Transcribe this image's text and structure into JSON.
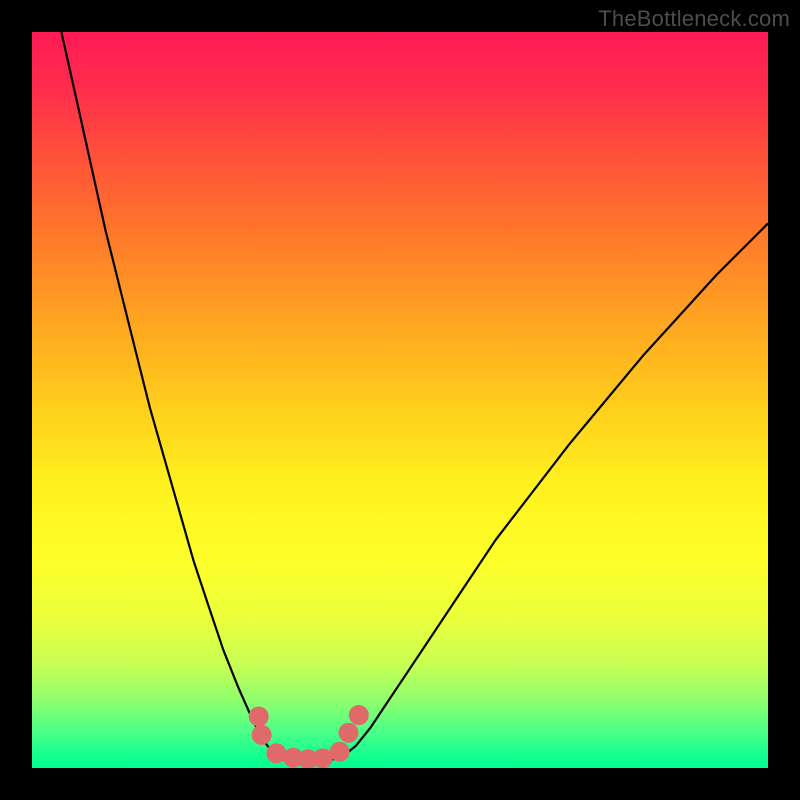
{
  "attribution": "TheBottleneck.com",
  "chart_data": {
    "type": "line",
    "title": "",
    "xlabel": "",
    "ylabel": "",
    "xlim": [
      0,
      100
    ],
    "ylim": [
      0,
      100
    ],
    "series": [
      {
        "name": "left-curve",
        "x": [
          4,
          6,
          8,
          10,
          12,
          14,
          16,
          18,
          20,
          22,
          24,
          26,
          28,
          30,
          31,
          32,
          33,
          33.5
        ],
        "y": [
          100,
          91,
          82,
          73,
          65,
          57,
          49,
          42,
          35,
          28,
          22,
          16,
          11,
          6.5,
          4.5,
          3,
          2,
          1.5
        ]
      },
      {
        "name": "valley",
        "x": [
          33.5,
          34.5,
          36,
          38,
          40,
          41.5,
          42.5
        ],
        "y": [
          1.5,
          1,
          0.8,
          0.8,
          1,
          1.3,
          1.8
        ]
      },
      {
        "name": "right-curve",
        "x": [
          42.5,
          44,
          46,
          48,
          51,
          55,
          59,
          63,
          68,
          73,
          78,
          83,
          88,
          93,
          98,
          100
        ],
        "y": [
          1.8,
          3,
          5.5,
          8.5,
          13,
          19,
          25,
          31,
          37.5,
          44,
          50,
          56,
          61.5,
          67,
          72,
          74
        ]
      }
    ],
    "markers": {
      "name": "salmon-dots",
      "x": [
        30.8,
        31.2,
        33.2,
        35.5,
        37.5,
        39.5,
        41.8,
        43.0,
        44.4
      ],
      "y": [
        7.0,
        4.5,
        2.0,
        1.4,
        1.2,
        1.3,
        2.2,
        4.8,
        7.2
      ]
    },
    "colors": {
      "curve": "#000000",
      "marker": "#e06a6a",
      "gradient_top": "#ff1a55",
      "gradient_bottom": "#00ff90"
    }
  }
}
